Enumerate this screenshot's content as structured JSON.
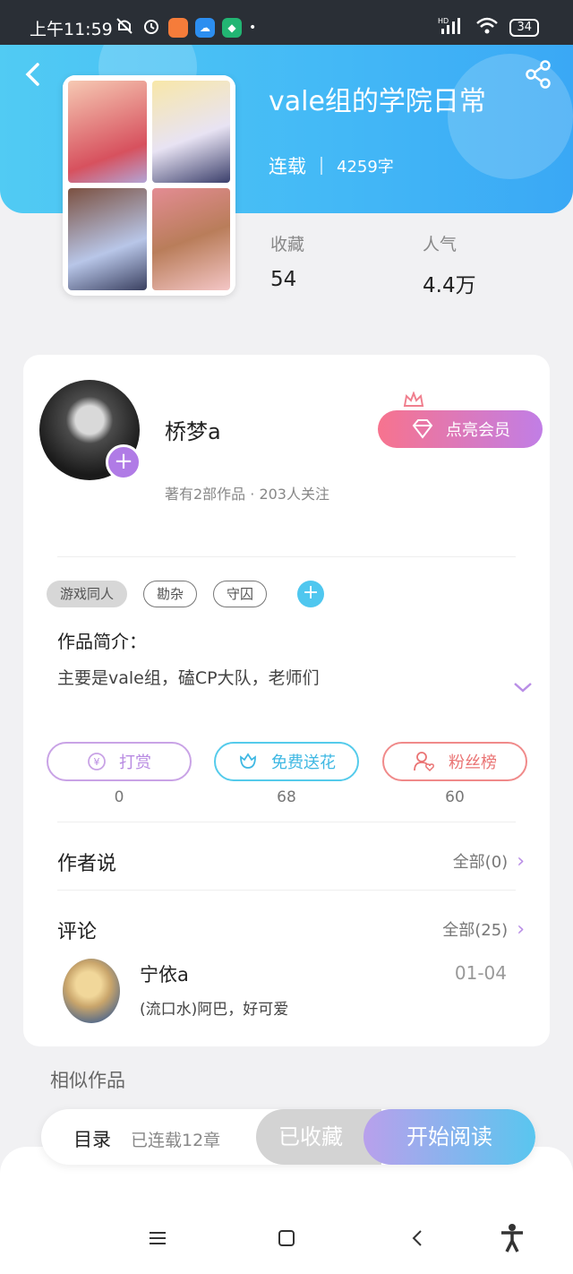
{
  "status_bar": {
    "time": "上午11:59",
    "battery": "34",
    "network": "HD"
  },
  "book": {
    "title": "vale组的学院日常",
    "status": "连载",
    "word_count": "4259字",
    "stats": [
      {
        "label": "收藏",
        "value": "54"
      },
      {
        "label": "人气",
        "value": "4.4万"
      }
    ]
  },
  "author": {
    "name": "桥梦a",
    "summary": "著有2部作品 · 203人关注",
    "vip_label": "点亮会员"
  },
  "tags": [
    "游戏同人",
    "勘杂",
    "守囚"
  ],
  "intro": {
    "title": "作品简介：",
    "text": "主要是vale组，磕CP大队，老师们"
  },
  "actions": [
    {
      "label": "打赏",
      "count": "0"
    },
    {
      "label": "免费送花",
      "count": "68"
    },
    {
      "label": "粉丝榜",
      "count": "60"
    }
  ],
  "author_says": {
    "title": "作者说",
    "more": "全部(0)"
  },
  "comments": {
    "title": "评论",
    "more": "全部(25)",
    "items": [
      {
        "name": "宁依a",
        "date": "01-04",
        "text": "(流口水)阿巴，好可爱"
      }
    ]
  },
  "similar_title": "相似作品",
  "bottom_bar": {
    "toc": "目录",
    "serial": "已连载12章",
    "saved": "已收藏",
    "read": "开始阅读"
  },
  "colors": {
    "header_start": "#51cbf3",
    "header_end": "#3aa8f5",
    "accent_purple": "#b07be6",
    "accent_cyan": "#4fc7ef",
    "accent_pink": "#f7738e"
  }
}
